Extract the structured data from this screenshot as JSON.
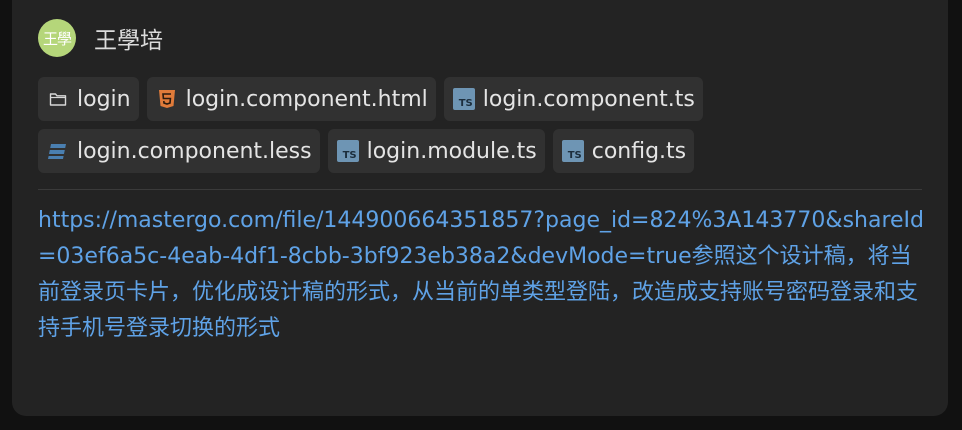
{
  "author": {
    "avatar_text": "王學",
    "name": "王學培",
    "avatar_color": "#b5d67a"
  },
  "files": [
    {
      "name": "login",
      "icon": "folder-icon"
    },
    {
      "name": "login.component.html",
      "icon": "html5-icon"
    },
    {
      "name": "login.component.ts",
      "icon": "typescript-icon"
    },
    {
      "name": "login.component.less",
      "icon": "css-icon"
    },
    {
      "name": "login.module.ts",
      "icon": "typescript-icon"
    },
    {
      "name": "config.ts",
      "icon": "typescript-icon"
    }
  ],
  "message": {
    "link": "https://mastergo.com/file/144900664351857?page_id=824%3A143770&shareId=03ef6a5c-4eab-4df1-8cbb-3bf923eb38a2&devMode=true",
    "text": "参照这个设计稿，将当前登录页卡片，优化成设计稿的形式，从当前的单类型登陆，改造成支持账号密码登录和支持手机号登录切换的形式"
  },
  "colors": {
    "background": "#111111",
    "card": "#232323",
    "chip": "#313131",
    "text": "#e4e4e4",
    "link": "#5fa2e6",
    "html_icon": "#e07b3a",
    "css_icon": "#4a7fb0",
    "ts_icon": "#6e95b4"
  }
}
